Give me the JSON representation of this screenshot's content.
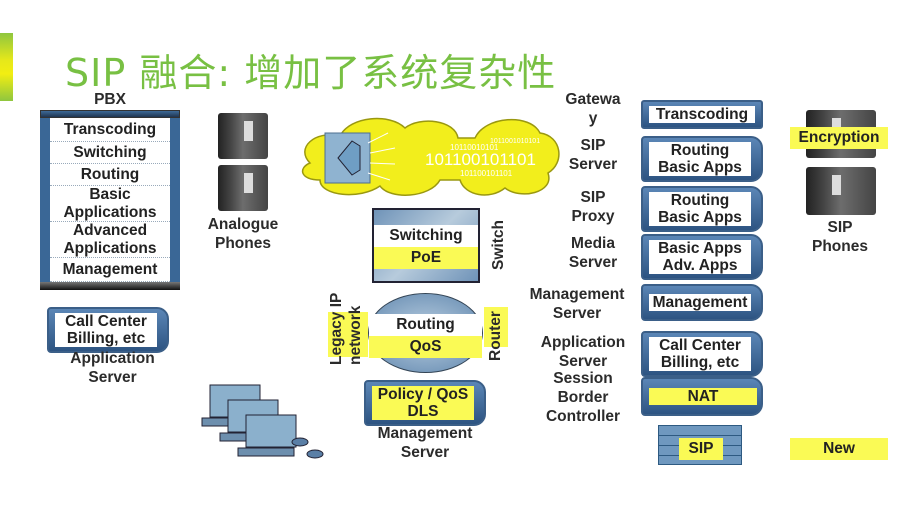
{
  "title": "SIP 融合: 增加了系统复杂性",
  "colors": {
    "title": "#78c043",
    "highlight": "#fafa55",
    "server_blue": "#3b6796",
    "cloud": "#f2ee1c"
  },
  "pbx": {
    "label": "PBX",
    "rows": [
      "Transcoding",
      "Switching",
      "Routing",
      "Basic Applications",
      "Advanced Applications",
      "Management"
    ]
  },
  "app_server_left": {
    "lines": [
      "Call Center",
      "Billing, etc"
    ],
    "label": [
      "Application",
      "Server"
    ]
  },
  "analogue_phones": {
    "label": [
      "Analogue",
      "Phones"
    ]
  },
  "cloud": {
    "icon": "speaker-icon",
    "binary_main": "101100101101",
    "binary_small": [
      "10110010101",
      "1011001010101",
      "101100101101",
      "10110010101101"
    ]
  },
  "switch": {
    "rows": [
      "Switching",
      "PoE"
    ],
    "label": "Switch"
  },
  "router": {
    "rows": [
      "Routing",
      "QoS"
    ],
    "label": "Router",
    "side_label": [
      "Legacy IP",
      "network"
    ]
  },
  "mgmt_server_center": {
    "lines": [
      "Policy / QoS",
      "DLS"
    ],
    "label": [
      "Management",
      "Server"
    ]
  },
  "right_stack": [
    {
      "label": [
        "Gatewa",
        "y"
      ],
      "box": [
        "Transcoding"
      ]
    },
    {
      "label": [
        "SIP",
        "Server"
      ],
      "box": [
        "Routing",
        "Basic Apps"
      ]
    },
    {
      "label": [
        "SIP",
        "Proxy"
      ],
      "box": [
        "Routing",
        "Basic Apps"
      ]
    },
    {
      "label": [
        "Media",
        "Server"
      ],
      "box": [
        "Basic Apps",
        "Adv. Apps"
      ]
    },
    {
      "label": [
        "Management",
        "Server"
      ],
      "box": [
        "Management"
      ]
    },
    {
      "label": [
        "Application",
        "Server"
      ],
      "box": [
        "Call Center",
        "Billing, etc"
      ]
    },
    {
      "label": [
        "Session",
        "Border",
        "Controller"
      ],
      "box": [
        "NAT"
      ]
    }
  ],
  "firewall": {
    "label": "SIP"
  },
  "sip_phones": {
    "badge": "Encryption",
    "label": [
      "SIP",
      "Phones"
    ]
  },
  "legend": {
    "new_label": "New"
  }
}
